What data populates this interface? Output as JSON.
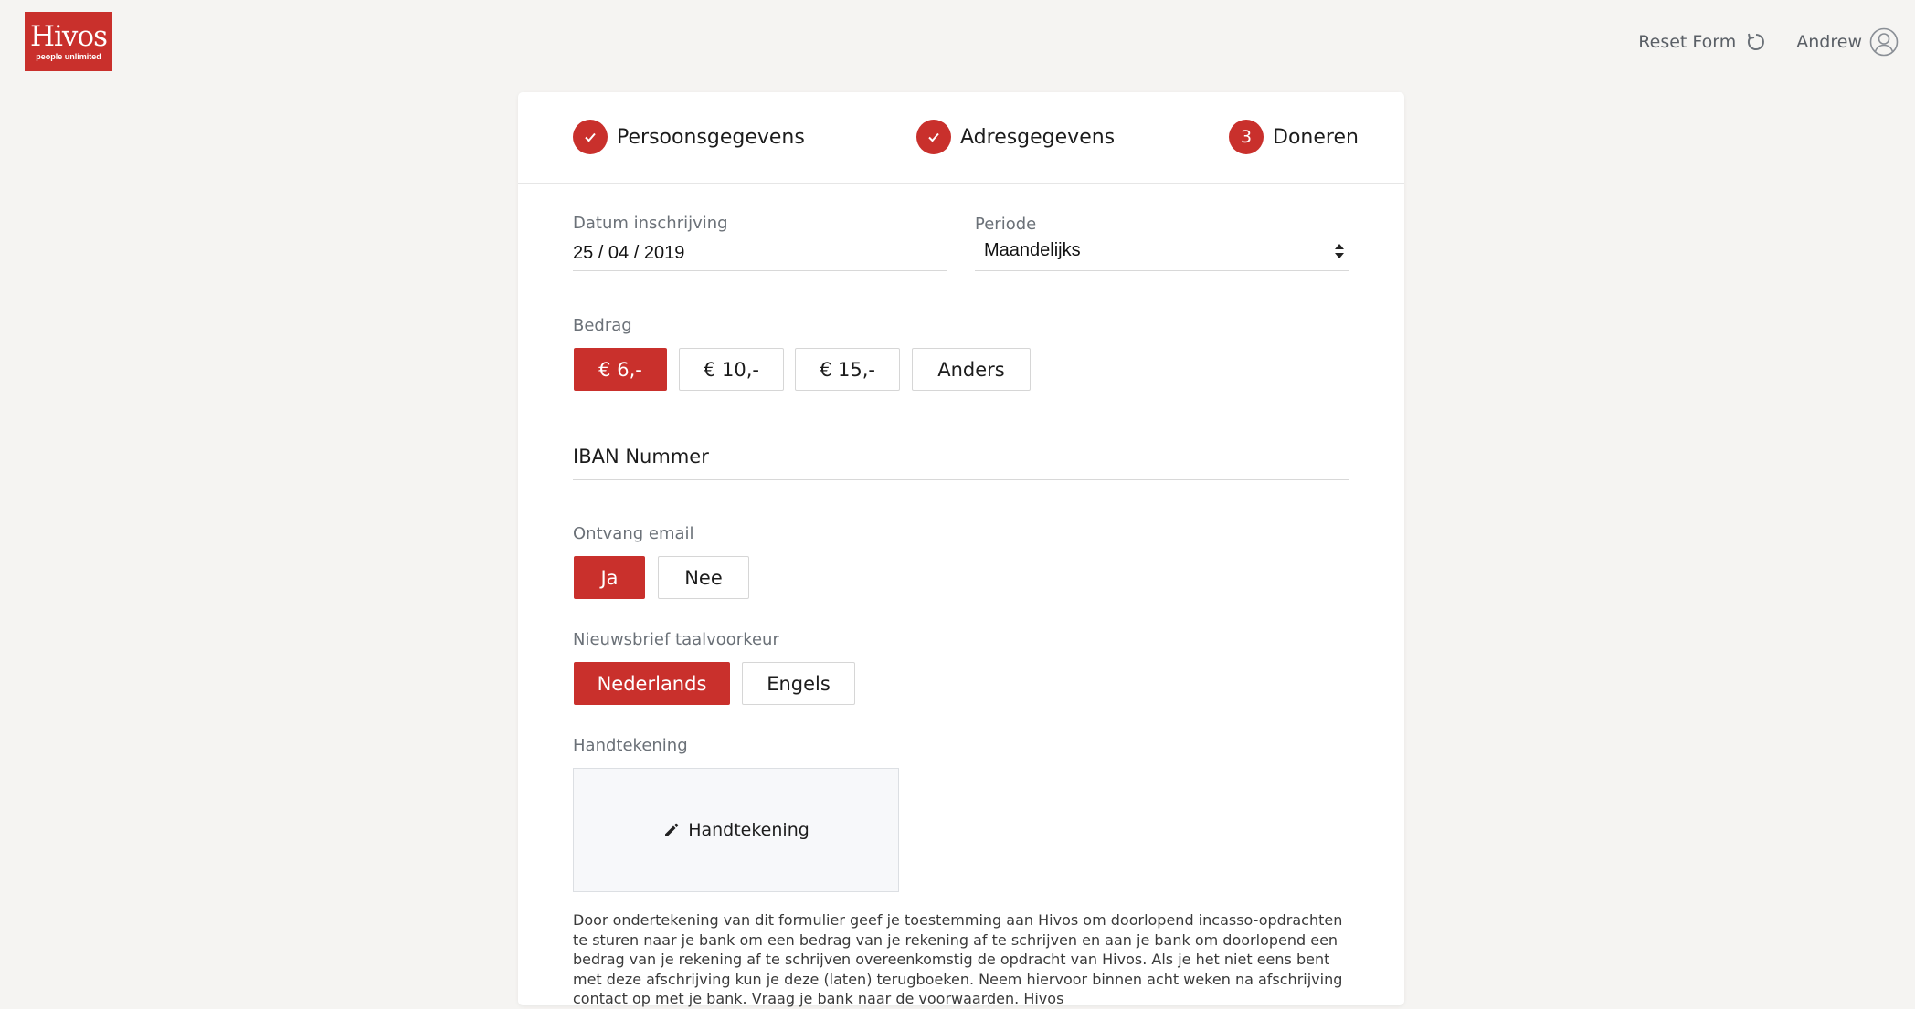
{
  "brand": {
    "logo_word": "Hivos",
    "logo_tagline": "people unlimited",
    "color": "#c9302c"
  },
  "topbar": {
    "reset_label": "Reset Form",
    "user_name": "Andrew"
  },
  "steps": [
    {
      "label": "Persoonsgegevens",
      "status": "done"
    },
    {
      "label": "Adresgegevens",
      "status": "done"
    },
    {
      "label": "Doneren",
      "status": "current",
      "number": "3"
    }
  ],
  "form": {
    "date_label": "Datum inschrijving",
    "date_value": "25 / 04 / 2019",
    "period_label": "Periode",
    "period_value": "Maandelijks",
    "amount_label": "Bedrag",
    "amounts": [
      "€ 6,-",
      "€ 10,-",
      "€ 15,-",
      "Anders"
    ],
    "amount_selected": "€ 6,-",
    "iban_placeholder": "IBAN Nummer",
    "email_label": "Ontvang email",
    "email_options": [
      "Ja",
      "Nee"
    ],
    "email_selected": "Ja",
    "newsletter_label": "Nieuwsbrief taalvoorkeur",
    "newsletter_options": [
      "Nederlands",
      "Engels"
    ],
    "newsletter_selected": "Nederlands",
    "signature_label": "Handtekening",
    "signature_button": "Handtekening",
    "legal_text": "Door ondertekening van dit formulier geef je toestemming aan Hivos om doorlopend incasso-opdrachten te sturen naar je bank om een bedrag van je rekening af te schrijven en aan je bank om doorlopend een bedrag van je rekening af te schrijven overeenkomstig de opdracht van Hivos. Als je het niet eens bent met deze afschrijving kun je deze (laten) terugboeken. Neem hiervoor binnen acht weken na afschrijving contact op met je bank. Vraag je bank naar de voorwaarden. Hivos"
  }
}
